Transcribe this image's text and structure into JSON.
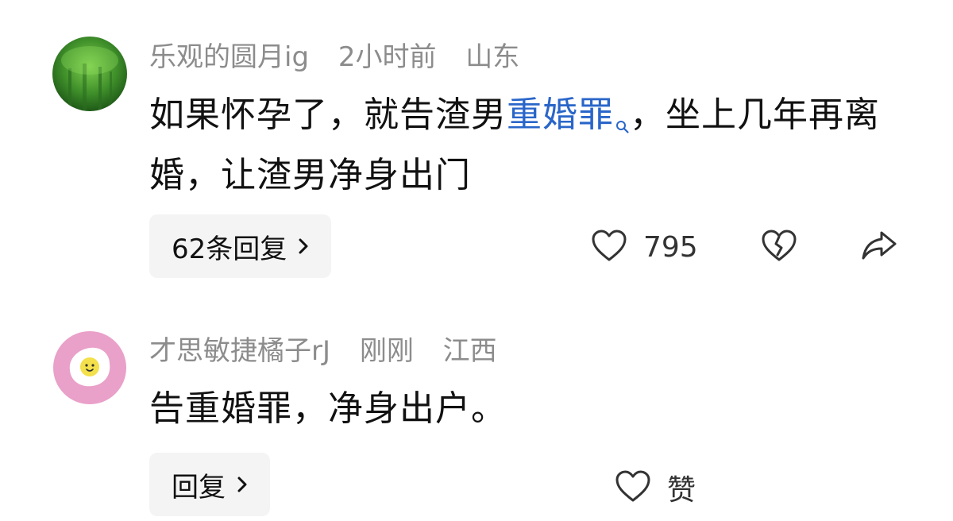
{
  "comments": [
    {
      "username": "乐观的圆月ig",
      "time": "2小时前",
      "location": "山东",
      "content_before": "如果怀孕了，就告渣男",
      "content_link": "重婚罪",
      "content_after": "，坐上几年再离婚，让渣男净身出门",
      "reply_label": "62条回复",
      "like_count": "795",
      "icons": [
        "like-heart-icon",
        "broken-heart-icon",
        "share-arrow-icon"
      ]
    },
    {
      "username": "才思敏捷橘子rJ",
      "time": "刚刚",
      "location": "江西",
      "content": "告重婚罪，净身出户。",
      "reply_label": "回复",
      "like_label": "赞",
      "icons": [
        "like-heart-icon"
      ]
    }
  ],
  "colors": {
    "meta_text": "#8c8c8c",
    "link": "#2a66c9",
    "button_bg": "#f4f4f4",
    "avatar_green": "#3f8f2a",
    "avatar_pink": "#e9a0c9"
  }
}
